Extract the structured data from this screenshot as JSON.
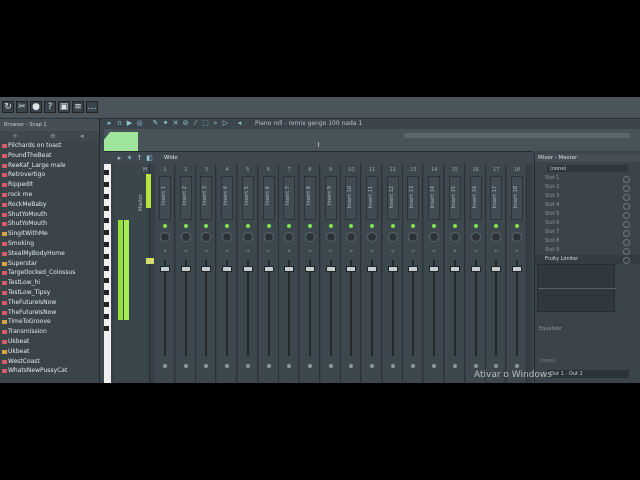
{
  "app": {
    "watermark": "Ativar o Windows"
  },
  "pianoroll": {
    "title": "Piano roll - remix gengo 100 nada 1"
  },
  "browser": {
    "header": "Browser - Snap 1",
    "items": [
      {
        "label": "Pilchards on toast",
        "type": "file"
      },
      {
        "label": "PoundTheBeat",
        "type": "file"
      },
      {
        "label": "ReeKaf_Large male",
        "type": "file"
      },
      {
        "label": "Retrovertigo",
        "type": "file"
      },
      {
        "label": "RippedIt",
        "type": "file"
      },
      {
        "label": "rock me",
        "type": "file"
      },
      {
        "label": "RockMeBaby",
        "type": "file"
      },
      {
        "label": "ShutYoMouth",
        "type": "file"
      },
      {
        "label": "ShutYoMouth",
        "type": "file"
      },
      {
        "label": "SingItWithMe",
        "type": "folder"
      },
      {
        "label": "Smoking",
        "type": "file"
      },
      {
        "label": "StealMyBodyHome",
        "type": "file"
      },
      {
        "label": "Superstar",
        "type": "folder"
      },
      {
        "label": "Targetlocked_Colossus",
        "type": "file"
      },
      {
        "label": "TestLow_hi",
        "type": "file"
      },
      {
        "label": "TestLow_Tipsy",
        "type": "file"
      },
      {
        "label": "TheFutureIsNow",
        "type": "file"
      },
      {
        "label": "TheFutureIsNow",
        "type": "file"
      },
      {
        "label": "TimeToGroove",
        "type": "folder"
      },
      {
        "label": "Transmission",
        "type": "file"
      },
      {
        "label": "Ukbeat",
        "type": "file"
      },
      {
        "label": "Ukbeat",
        "type": "folder"
      },
      {
        "label": "WestCoast",
        "type": "file"
      },
      {
        "label": "WhatsNewPussyCat",
        "type": "file"
      }
    ]
  },
  "mixer": {
    "view_label": "Wide",
    "inserts": [
      {
        "num": "1",
        "name": "Insert 1"
      },
      {
        "num": "2",
        "name": "Insert 2"
      },
      {
        "num": "3",
        "name": "Insert 3"
      },
      {
        "num": "4",
        "name": "Insert 4"
      },
      {
        "num": "5",
        "name": "Insert 5"
      },
      {
        "num": "6",
        "name": "Insert 6"
      },
      {
        "num": "7",
        "name": "Insert 7"
      },
      {
        "num": "8",
        "name": "Insert 8"
      },
      {
        "num": "9",
        "name": "Insert 9"
      },
      {
        "num": "10",
        "name": "Insert 10"
      },
      {
        "num": "11",
        "name": "Insert 11"
      },
      {
        "num": "12",
        "name": "Insert 12"
      },
      {
        "num": "13",
        "name": "Insert 13"
      },
      {
        "num": "14",
        "name": "Insert 14"
      },
      {
        "num": "15",
        "name": "Insert 15"
      },
      {
        "num": "16",
        "name": "Insert 16"
      },
      {
        "num": "17",
        "name": "Insert 17"
      },
      {
        "num": "18",
        "name": "Insert 18"
      }
    ],
    "master_label": "M",
    "master_name": "Master"
  },
  "mixer_panel": {
    "title": "Mixer - Master",
    "input": "(none)",
    "slots": [
      "Slot 1",
      "Slot 2",
      "Slot 3",
      "Slot 4",
      "Slot 5",
      "Slot 6",
      "Slot 7",
      "Slot 8",
      "Slot 9",
      "Fruity Limiter"
    ],
    "eq_label": "Equalizer",
    "none_label": "(none)",
    "output": "Out 1 - Out 2"
  }
}
